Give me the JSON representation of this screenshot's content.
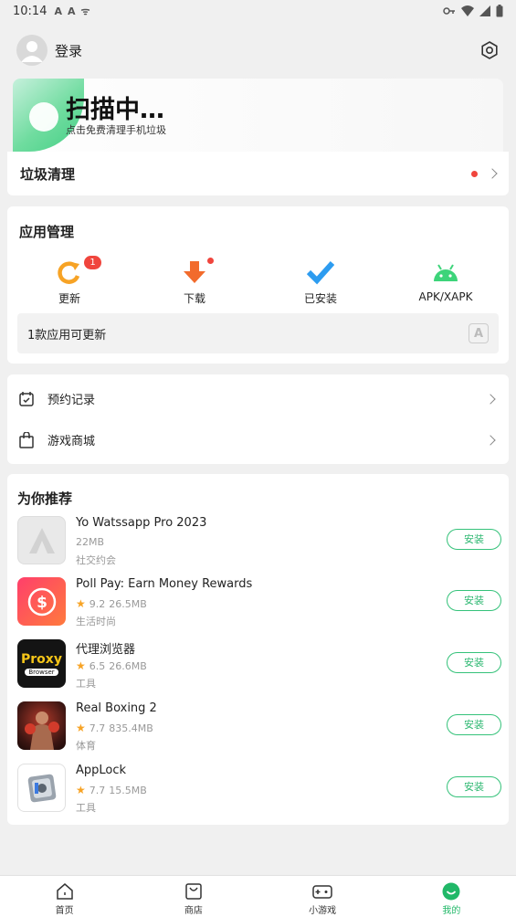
{
  "status": {
    "time": "10:14",
    "notif_icons": [
      "A",
      "A",
      "ᯤ"
    ]
  },
  "header": {
    "login_label": "登录"
  },
  "scan": {
    "title": "扫描中…",
    "subtitle": "点击免费清理手机垃圾"
  },
  "junk": {
    "label": "垃圾清理"
  },
  "app_manager": {
    "title": "应用管理",
    "tools": [
      {
        "label": "更新",
        "icon": "refresh-icon",
        "badge": "1"
      },
      {
        "label": "下载",
        "icon": "download-icon"
      },
      {
        "label": "已安装",
        "icon": "check-icon"
      },
      {
        "label": "APK/XAPK",
        "icon": "android-icon"
      }
    ],
    "update_notice": "1款应用可更新"
  },
  "links": [
    {
      "label": "预约记录",
      "icon": "calendar-check-icon"
    },
    {
      "label": "游戏商城",
      "icon": "shopping-bag-icon"
    }
  ],
  "recommend": {
    "title": "为你推荐",
    "install_label": "安装",
    "apps": [
      {
        "name": "Yo Watssapp Pro 2023",
        "rating": "",
        "size": "22MB",
        "category": "社交约会"
      },
      {
        "name": "Poll Pay: Earn Money Rewards",
        "rating": "9.2",
        "size": "26.5MB",
        "category": "生活时尚"
      },
      {
        "name": "代理浏览器",
        "rating": "6.5",
        "size": "26.6MB",
        "category": "工具",
        "icon_text": "Proxy",
        "icon_sub": "Browser"
      },
      {
        "name": "Real Boxing 2",
        "rating": "7.7",
        "size": "835.4MB",
        "category": "体育"
      },
      {
        "name": "AppLock",
        "rating": "7.7",
        "size": "15.5MB",
        "category": "工具"
      }
    ]
  },
  "nav": [
    {
      "label": "首页",
      "icon": "home-icon"
    },
    {
      "label": "商店",
      "icon": "store-icon"
    },
    {
      "label": "小游戏",
      "icon": "gamepad-icon"
    },
    {
      "label": "我的",
      "icon": "smile-icon",
      "active": true
    }
  ],
  "colors": {
    "accent": "#21b868",
    "badge": "#f0453d",
    "star": "#f7a325"
  }
}
